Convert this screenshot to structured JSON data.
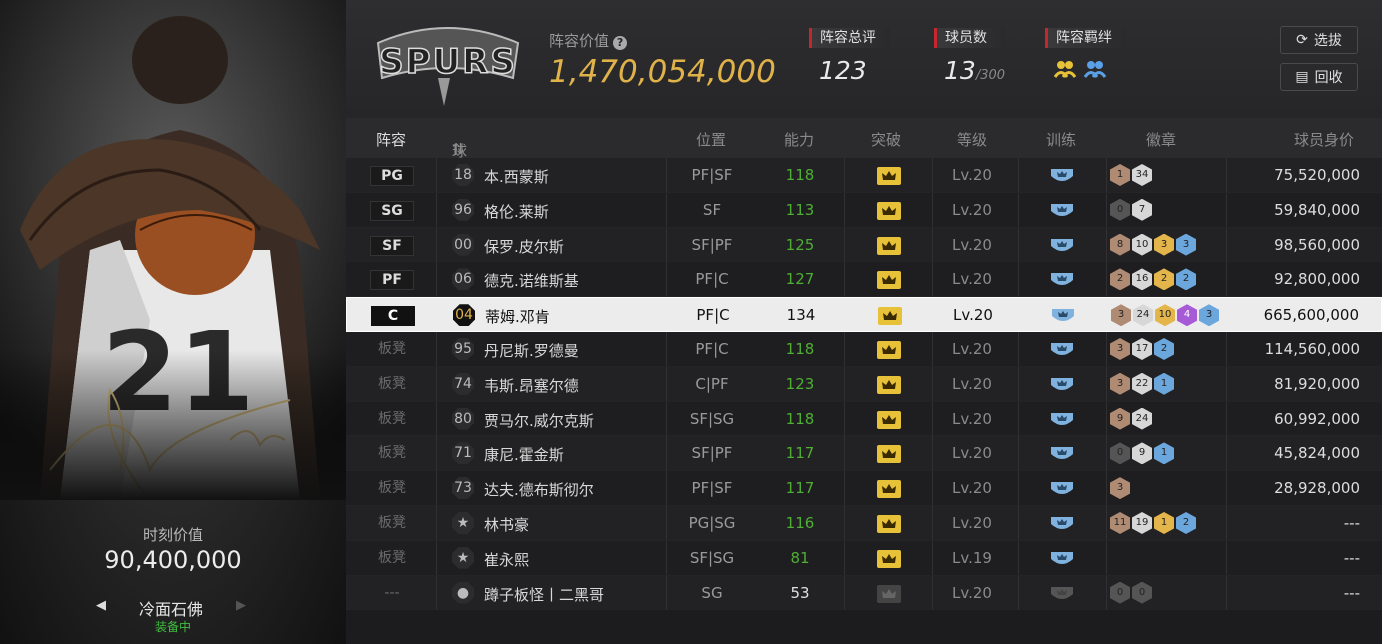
{
  "card": {
    "moment_label": "时刻价值",
    "moment_value": "90,400,000",
    "name": "冷面石佛",
    "status": "装备中",
    "jersey": "21"
  },
  "team": {
    "value_label": "阵容价值",
    "value": "1,470,054,000"
  },
  "stats": {
    "rating_label": "阵容总评",
    "rating": "123",
    "players_label": "球员数",
    "players": "13",
    "players_max": "/300",
    "bond_label": "阵容羁绊"
  },
  "buttons": {
    "select": "选拔",
    "recycle": "回收"
  },
  "columns": {
    "lineup": "阵容",
    "name": "球员名",
    "position": "位置",
    "ability": "能力",
    "breakthrough": "突破",
    "level": "等级",
    "training": "训练",
    "badges": "徽章",
    "price": "球员身价"
  },
  "rows": [
    {
      "slot": "PG",
      "num": "18",
      "name": "本.西蒙斯",
      "pos": "PF|SF",
      "ability": "118",
      "level": "Lv.20",
      "badges": [
        [
          "br",
          "1"
        ],
        [
          "sv",
          "34"
        ]
      ],
      "price": "75,520,000"
    },
    {
      "slot": "SG",
      "num": "96",
      "name": "格伦.莱斯",
      "pos": "SF",
      "ability": "113",
      "level": "Lv.20",
      "badges": [
        [
          "dk",
          "0"
        ],
        [
          "sv",
          "7"
        ]
      ],
      "price": "59,840,000"
    },
    {
      "slot": "SF",
      "num": "00",
      "name": "保罗.皮尔斯",
      "pos": "SF|PF",
      "ability": "125",
      "level": "Lv.20",
      "badges": [
        [
          "br",
          "8"
        ],
        [
          "sv",
          "10"
        ],
        [
          "gd",
          "3"
        ],
        [
          "bl",
          "3"
        ]
      ],
      "price": "98,560,000"
    },
    {
      "slot": "PF",
      "num": "06",
      "name": "德克.诺维斯基",
      "pos": "PF|C",
      "ability": "127",
      "level": "Lv.20",
      "badges": [
        [
          "br",
          "2"
        ],
        [
          "sv",
          "16"
        ],
        [
          "gd",
          "2"
        ],
        [
          "bl",
          "2"
        ]
      ],
      "price": "92,800,000"
    },
    {
      "slot": "C",
      "num": "04",
      "name": "蒂姆.邓肯",
      "pos": "PF|C",
      "ability": "134",
      "level": "Lv.20",
      "badges": [
        [
          "br",
          "3"
        ],
        [
          "sv",
          "24"
        ],
        [
          "gd",
          "10"
        ],
        [
          "pu",
          "4"
        ],
        [
          "bl",
          "3"
        ]
      ],
      "price": "665,600,000"
    },
    {
      "slot": "板凳",
      "num": "95",
      "name": "丹尼斯.罗德曼",
      "pos": "PF|C",
      "ability": "118",
      "level": "Lv.20",
      "badges": [
        [
          "br",
          "3"
        ],
        [
          "sv",
          "17"
        ],
        [
          "bl",
          "2"
        ]
      ],
      "price": "114,560,000"
    },
    {
      "slot": "板凳",
      "num": "74",
      "name": "韦斯.昂塞尔德",
      "pos": "C|PF",
      "ability": "123",
      "level": "Lv.20",
      "badges": [
        [
          "br",
          "3"
        ],
        [
          "sv",
          "22"
        ],
        [
          "bl",
          "1"
        ]
      ],
      "price": "81,920,000"
    },
    {
      "slot": "板凳",
      "num": "80",
      "name": "贾马尔.威尔克斯",
      "pos": "SF|SG",
      "ability": "118",
      "level": "Lv.20",
      "badges": [
        [
          "br",
          "9"
        ],
        [
          "sv",
          "24"
        ]
      ],
      "price": "60,992,000"
    },
    {
      "slot": "板凳",
      "num": "71",
      "name": "康尼.霍金斯",
      "pos": "SF|PF",
      "ability": "117",
      "level": "Lv.20",
      "badges": [
        [
          "dk",
          "0"
        ],
        [
          "sv",
          "9"
        ],
        [
          "bl",
          "1"
        ]
      ],
      "price": "45,824,000"
    },
    {
      "slot": "板凳",
      "num": "73",
      "name": "达夫.德布斯彻尔",
      "pos": "PF|SF",
      "ability": "117",
      "level": "Lv.20",
      "badges": [
        [
          "br",
          "3"
        ]
      ],
      "price": "28,928,000"
    },
    {
      "slot": "板凳",
      "num": "★",
      "name": "林书豪",
      "pos": "PG|SG",
      "ability": "116",
      "level": "Lv.20",
      "badges": [
        [
          "br",
          "11"
        ],
        [
          "sv",
          "19"
        ],
        [
          "gd",
          "1"
        ],
        [
          "bl",
          "2"
        ]
      ],
      "price": "---"
    },
    {
      "slot": "板凳",
      "num": "★",
      "name": "崔永熙",
      "pos": "SF|SG",
      "ability": "81",
      "level": "Lv.19",
      "badges": [],
      "price": "---"
    },
    {
      "slot": "---",
      "num": "●",
      "name": "蹲子板怪丨二黑哥",
      "pos": "SG",
      "ability": "53",
      "level": "Lv.20",
      "badges": [
        [
          "dk",
          "0"
        ],
        [
          "dk",
          "0"
        ]
      ],
      "price": "---"
    }
  ]
}
